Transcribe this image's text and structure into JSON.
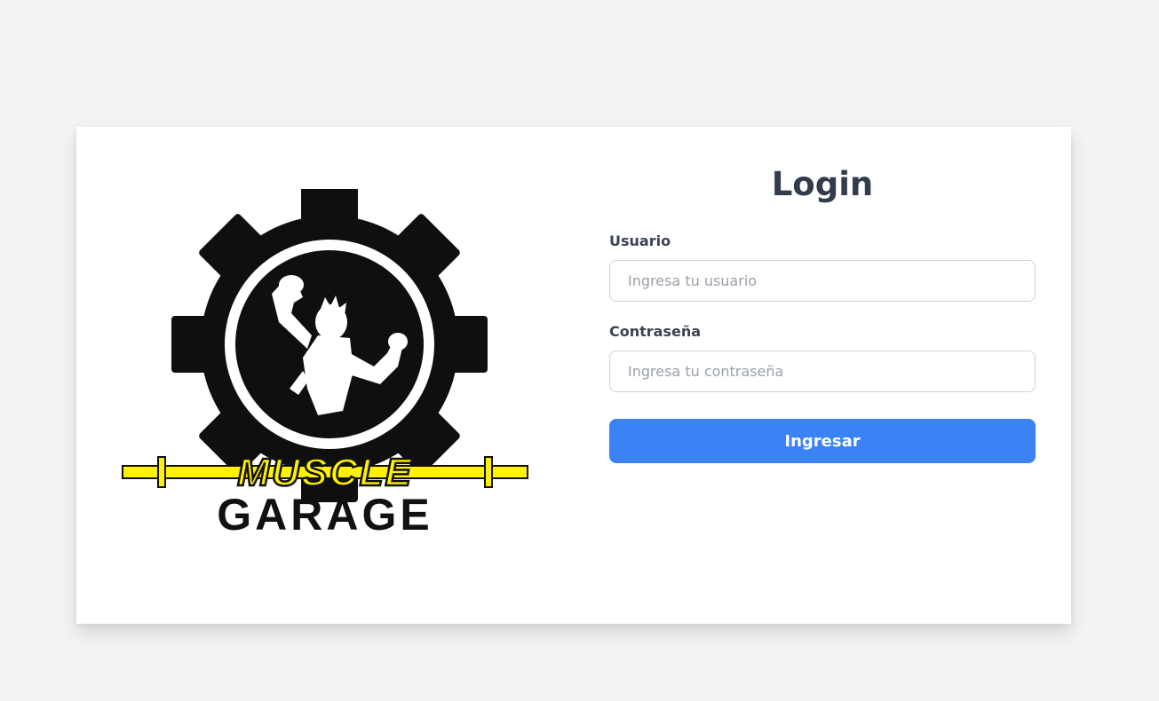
{
  "logo": {
    "line1": "MUSCLE",
    "line2": "GARAGE",
    "colors": {
      "gear": "#0f0f10",
      "ring": "#ffffff",
      "accent": "#fff200",
      "outline": "#111111"
    },
    "icon": "flexing-athlete-gear-logo"
  },
  "login": {
    "title": "Login",
    "username": {
      "label": "Usuario",
      "value": "",
      "placeholder": "Ingresa tu usuario"
    },
    "password": {
      "label": "Contraseña",
      "value": "",
      "placeholder": "Ingresa tu contraseña"
    },
    "submit_label": "Ingresar"
  },
  "colors": {
    "page_background": "#f2f3f5",
    "card_background": "#ffffff",
    "primary": "#3b82f6",
    "heading": "#333c4c"
  }
}
